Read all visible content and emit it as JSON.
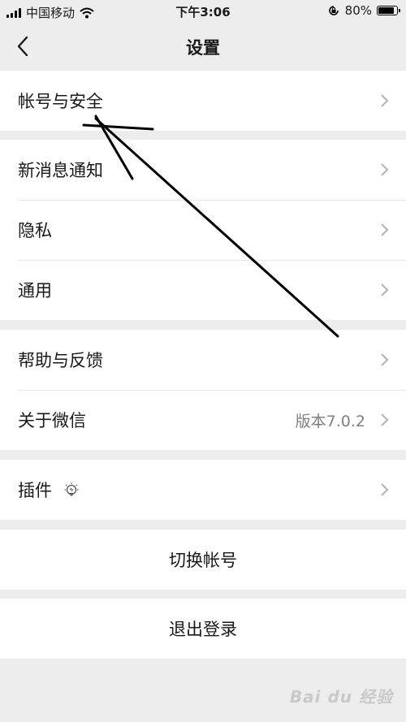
{
  "status_bar": {
    "carrier": "中国移动",
    "time": "下午3:06",
    "battery": "80%"
  },
  "nav": {
    "title": "设置"
  },
  "groups": {
    "account": {
      "label": "帐号与安全"
    },
    "notifications": {
      "label": "新消息通知"
    },
    "privacy": {
      "label": "隐私"
    },
    "general": {
      "label": "通用"
    },
    "help": {
      "label": "帮助与反馈"
    },
    "about": {
      "label": "关于微信",
      "value": "版本7.0.2"
    },
    "plugins": {
      "label": "插件"
    },
    "switch_account": {
      "label": "切换帐号"
    },
    "logout": {
      "label": "退出登录"
    }
  },
  "icons": [
    "signal-icon",
    "wifi-icon",
    "orientation-lock-icon",
    "battery-icon",
    "back-icon",
    "chevron-right-icon",
    "lightbulb-icon"
  ],
  "colors": {
    "background": "#ededed",
    "cell": "#ffffff",
    "secondary_text": "#7f7f7f",
    "chevron": "#b2b2b2"
  },
  "watermark": "Bai du 经验"
}
